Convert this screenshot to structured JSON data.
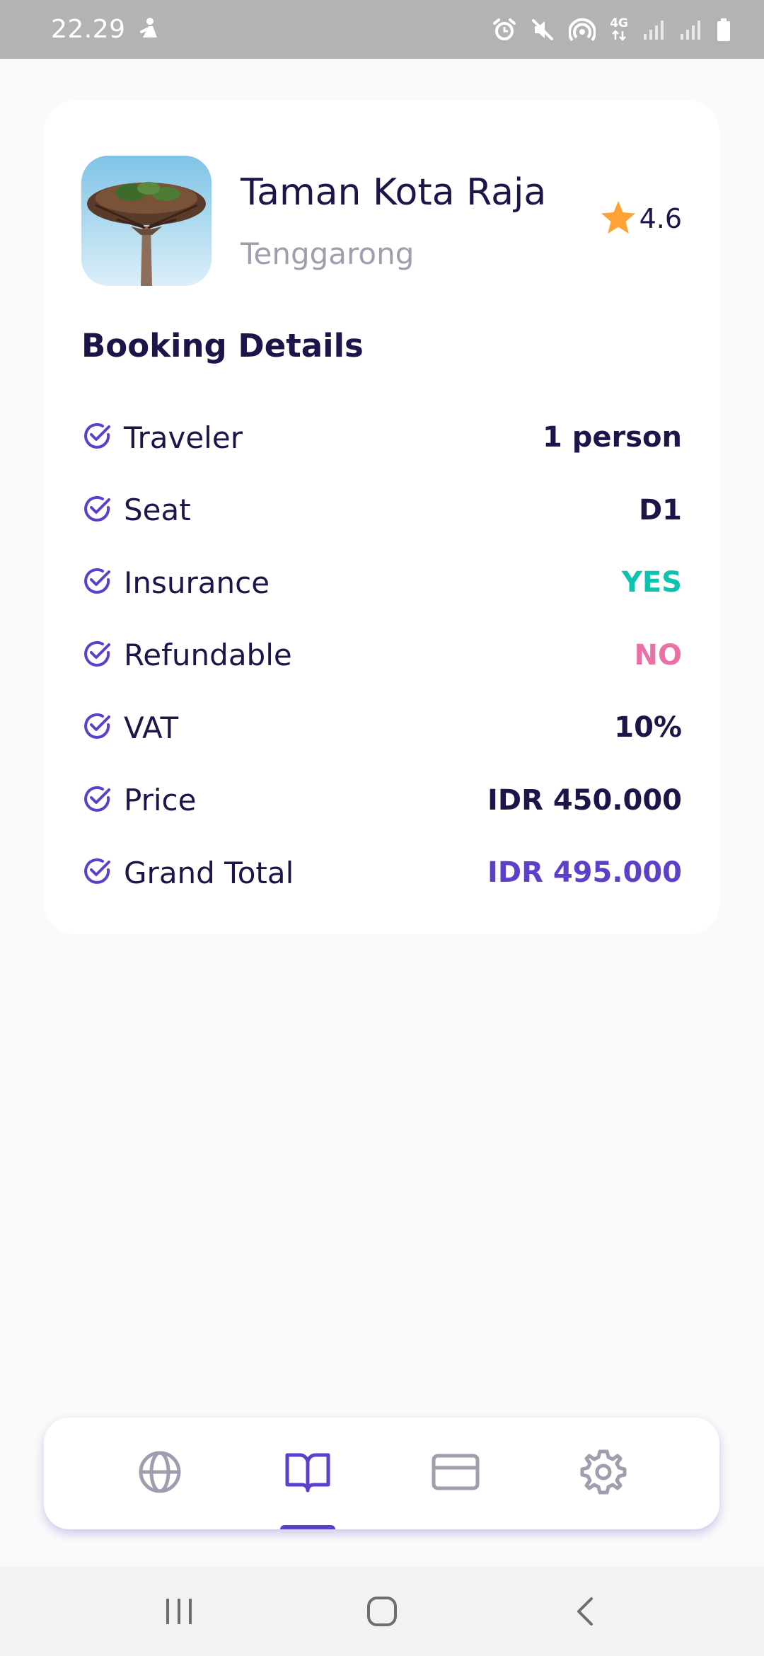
{
  "status_bar": {
    "time": "22.29",
    "icons": [
      "notification-icon",
      "alarm-icon",
      "mute-icon",
      "hotspot-icon",
      "4g-icon",
      "signal-icon",
      "signal-icon",
      "battery-icon"
    ],
    "network_label": "4G"
  },
  "destination": {
    "name": "Taman Kota Raja",
    "city": "Tenggarong",
    "rating": "4.6",
    "image": "supertree-photo"
  },
  "booking": {
    "title": "Booking Details",
    "rows": [
      {
        "label": "Traveler",
        "value": "1 person",
        "color": "#1F1449"
      },
      {
        "label": "Seat",
        "value": "D1",
        "color": "#1F1449"
      },
      {
        "label": "Insurance",
        "value": "YES",
        "color": "#0EC3AE"
      },
      {
        "label": "Refundable",
        "value": "NO",
        "color": "#EB70A5"
      },
      {
        "label": "VAT",
        "value": "10%",
        "color": "#1F1449"
      },
      {
        "label": "Price",
        "value": "IDR 450.000",
        "color": "#1F1449"
      },
      {
        "label": "Grand Total",
        "value": "IDR 495.000",
        "color": "#5C40CC"
      }
    ]
  },
  "bottom_nav": {
    "items": [
      {
        "icon": "globe-icon",
        "active": false
      },
      {
        "icon": "book-icon",
        "active": true
      },
      {
        "icon": "card-icon",
        "active": false
      },
      {
        "icon": "gear-icon",
        "active": false
      }
    ]
  },
  "colors": {
    "primary": "#5C40CC",
    "dark": "#1F1449",
    "grey": "#A09EAE",
    "green": "#0EC3AE",
    "pink": "#EB70A5",
    "star": "#FFA235"
  }
}
